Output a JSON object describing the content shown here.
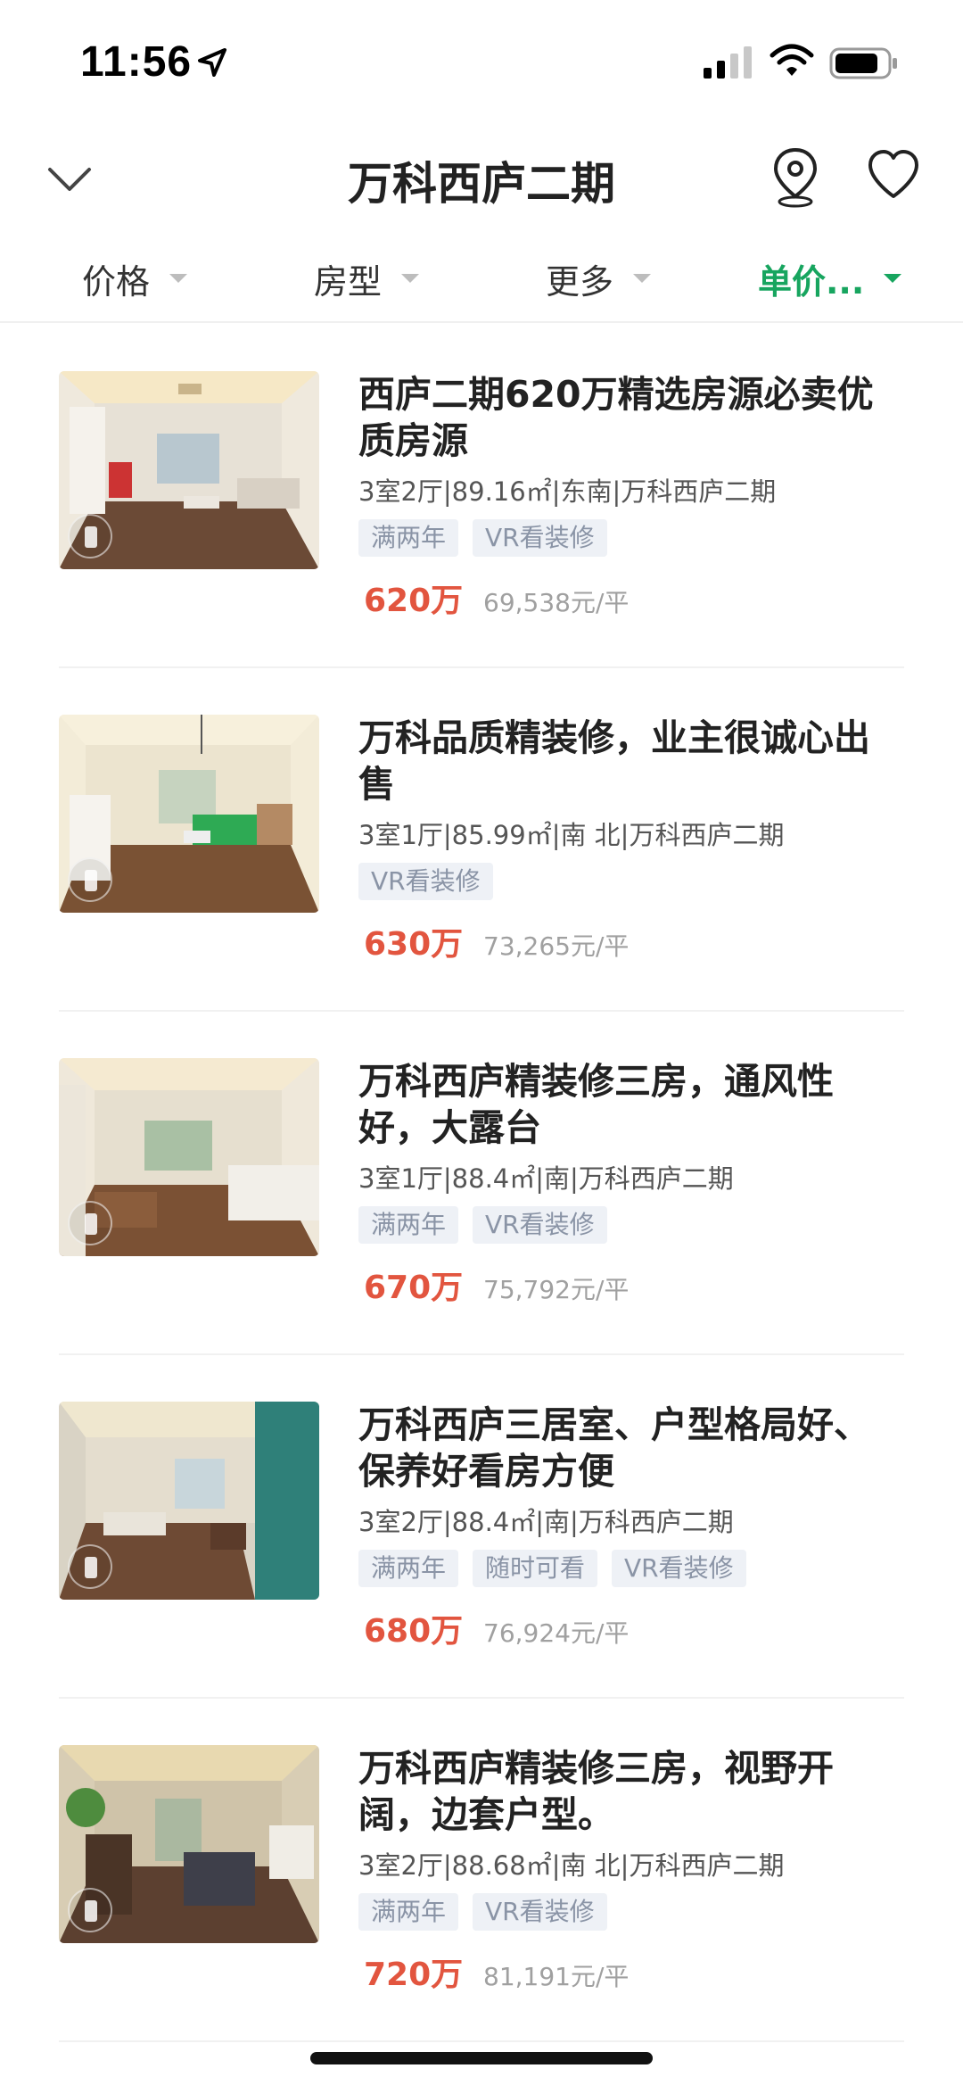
{
  "status_bar": {
    "time": "11:56"
  },
  "nav": {
    "title": "万科西庐二期"
  },
  "filters": [
    {
      "label": "价格",
      "active": false
    },
    {
      "label": "房型",
      "active": false
    },
    {
      "label": "更多",
      "active": false
    },
    {
      "label": "单价...",
      "active": true
    }
  ],
  "listings": [
    {
      "title": "西庐二期620万精选房源必卖优质房源",
      "meta": "3室2厅|89.16㎡|东南|万科西庐二期",
      "tags": [
        "满两年",
        "VR看装修"
      ],
      "price": "620万",
      "unit_price": "69,538元/平"
    },
    {
      "title": "万科品质精装修，业主很诚心出售",
      "meta": "3室1厅|85.99㎡|南 北|万科西庐二期",
      "tags": [
        "VR看装修"
      ],
      "price": "630万",
      "unit_price": "73,265元/平"
    },
    {
      "title": "万科西庐精装修三房，通风性好，大露台",
      "meta": "3室1厅|88.4㎡|南|万科西庐二期",
      "tags": [
        "满两年",
        "VR看装修"
      ],
      "price": "670万",
      "unit_price": "75,792元/平"
    },
    {
      "title": "万科西庐三居室、户型格局好、保养好看房方便",
      "meta": "3室2厅|88.4㎡|南|万科西庐二期",
      "tags": [
        "满两年",
        "随时可看",
        "VR看装修"
      ],
      "price": "680万",
      "unit_price": "76,924元/平"
    },
    {
      "title": "万科西庐精装修三房，视野开阔，边套户型。",
      "meta": "3室2厅|88.68㎡|南 北|万科西庐二期",
      "tags": [
        "满两年",
        "VR看装修"
      ],
      "price": "720万",
      "unit_price": "81,191元/平"
    }
  ],
  "colors": {
    "accent": "#17a55f",
    "price": "#e2553f",
    "tag_bg": "#eef1f6",
    "tag_text": "#8a94a6"
  }
}
